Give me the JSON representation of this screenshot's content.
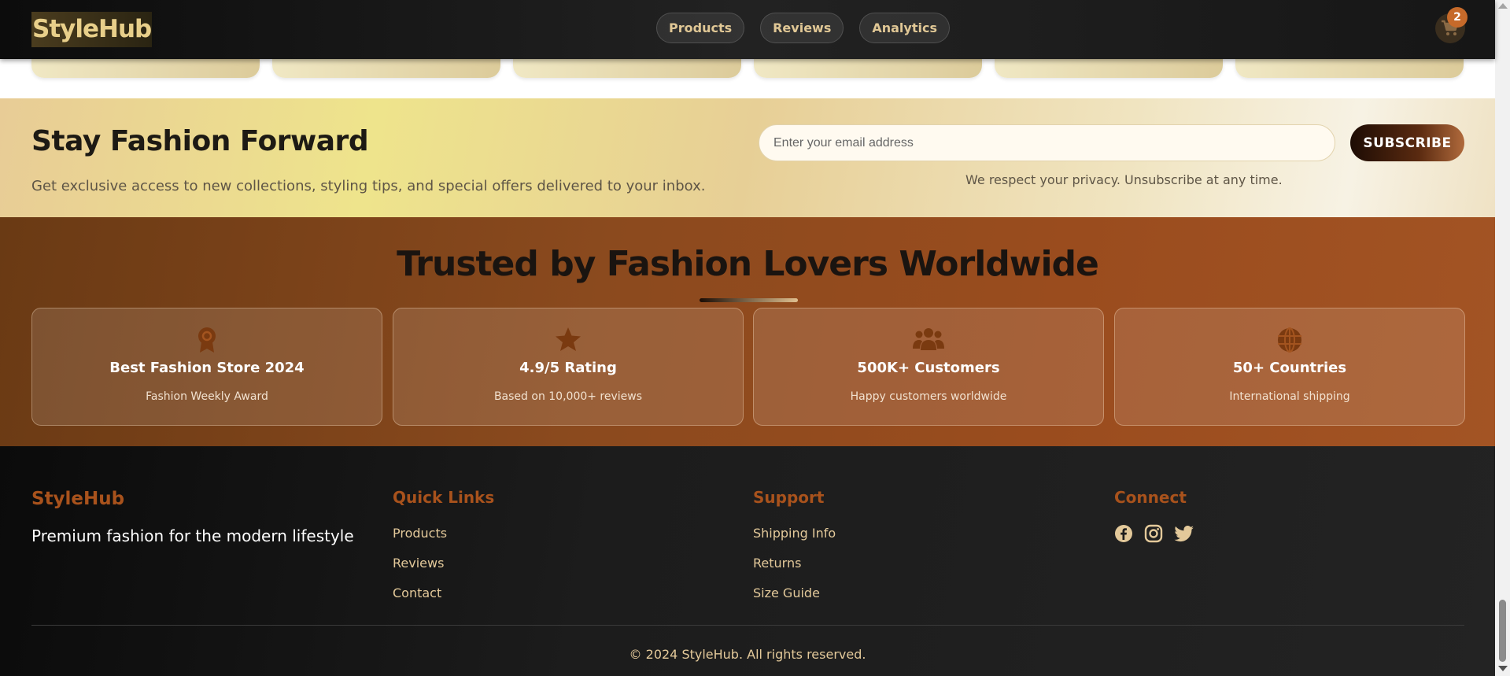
{
  "header": {
    "logo": "StyleHub",
    "nav": [
      "Products",
      "Reviews",
      "Analytics"
    ],
    "cart_icon": "shopping-cart-icon",
    "cart_count": "2"
  },
  "newsletter": {
    "title": "Stay Fashion Forward",
    "subtitle": "Get exclusive access to new collections, styling tips, and special offers delivered to your inbox.",
    "email_placeholder": "Enter your email address",
    "subscribe_label": "SUBSCRIBE",
    "privacy_note": "We respect your privacy. Unsubscribe at any time."
  },
  "trusted": {
    "title": "Trusted by Fashion Lovers Worldwide",
    "awards": [
      {
        "icon": "award-icon",
        "title": "Best Fashion Store 2024",
        "subtitle": "Fashion Weekly Award"
      },
      {
        "icon": "star-icon",
        "title": "4.9/5 Rating",
        "subtitle": "Based on 10,000+ reviews"
      },
      {
        "icon": "users-icon",
        "title": "500K+ Customers",
        "subtitle": "Happy customers worldwide"
      },
      {
        "icon": "globe-icon",
        "title": "50+ Countries",
        "subtitle": "International shipping"
      }
    ]
  },
  "footer": {
    "brand": "StyleHub",
    "tagline": "Premium fashion for the modern lifestyle",
    "quick_links": {
      "title": "Quick Links",
      "links": [
        "Products",
        "Reviews",
        "Contact"
      ]
    },
    "support": {
      "title": "Support",
      "links": [
        "Shipping Info",
        "Returns",
        "Size Guide"
      ]
    },
    "connect": {
      "title": "Connect",
      "icons": [
        "facebook-icon",
        "instagram-icon",
        "twitter-icon"
      ]
    },
    "copyright": "© 2024 StyleHub. All rights reserved."
  },
  "colors": {
    "accent_gold": "#e0c795",
    "accent_rust": "#a8521c",
    "header_bg": "#161616",
    "badge": "#c66a2a"
  }
}
